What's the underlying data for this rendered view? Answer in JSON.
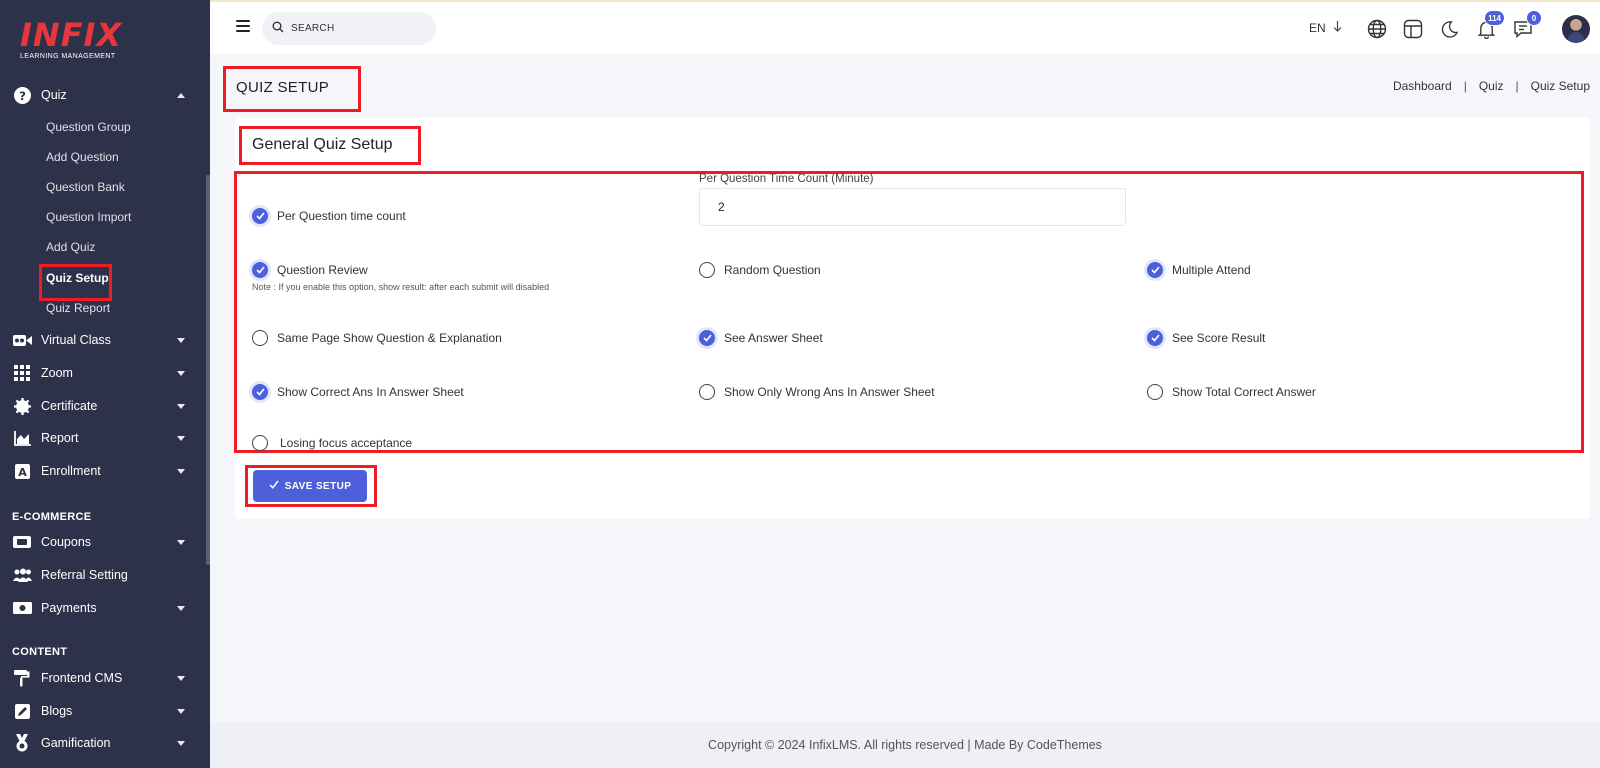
{
  "brand": {
    "name": "INFIX",
    "tagline": "LEARNING MANAGEMENT"
  },
  "sidebar": {
    "quiz": {
      "label": "Quiz",
      "items": [
        "Question Group",
        "Add Question",
        "Question Bank",
        "Question Import",
        "Add Quiz",
        "Quiz Setup",
        "Quiz Report"
      ]
    },
    "menu": [
      "Virtual Class",
      "Zoom",
      "Certificate",
      "Report",
      "Enrollment"
    ],
    "ecommerce_title": "E-COMMERCE",
    "ecommerce": [
      "Coupons",
      "Referral Setting",
      "Payments"
    ],
    "content_title": "CONTENT",
    "content": [
      "Frontend CMS",
      "Blogs",
      "Gamification"
    ]
  },
  "header": {
    "search_placeholder": "SEARCH",
    "lang": "EN",
    "notifications_count": "114",
    "messages_count": "0"
  },
  "page": {
    "title": "QUIZ SETUP",
    "breadcrumb": [
      "Dashboard",
      "Quiz",
      "Quiz Setup"
    ]
  },
  "card": {
    "title": "General Quiz Setup",
    "time_field_label": "Per Question Time Count (Minute)",
    "time_field_value": "2",
    "note": "Note : If you enable this option, show result: after each submit will disabled",
    "options": {
      "per_question_time": {
        "label": "Per Question time count",
        "checked": true
      },
      "question_review": {
        "label": "Question Review",
        "checked": true
      },
      "random_question": {
        "label": "Random Question",
        "checked": false
      },
      "multiple_attend": {
        "label": "Multiple Attend",
        "checked": true
      },
      "same_page": {
        "label": "Same Page Show Question & Explanation",
        "checked": false
      },
      "see_answer_sheet": {
        "label": "See Answer Sheet",
        "checked": true
      },
      "see_score_result": {
        "label": "See Score Result",
        "checked": true
      },
      "show_correct_ans": {
        "label": "Show Correct Ans In Answer Sheet",
        "checked": true
      },
      "show_only_wrong": {
        "label": "Show Only Wrong Ans In Answer Sheet",
        "checked": false
      },
      "show_total_correct": {
        "label": "Show Total Correct Answer",
        "checked": false
      },
      "losing_focus": {
        "label": "Losing focus acceptance",
        "checked": false
      }
    },
    "save_label": "SAVE SETUP"
  },
  "footer": {
    "text": "Copyright © 2024 InfixLMS. All rights reserved | Made By CodeThemes"
  },
  "colors": {
    "sidebar": "#2d3149",
    "accent": "#4e5fdc",
    "highlight": "#ee1c24",
    "brand": "#e8363b"
  }
}
